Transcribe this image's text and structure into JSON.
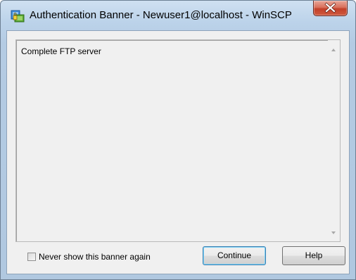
{
  "window": {
    "title": "Authentication Banner - Newuser1@localhost - WinSCP",
    "app_icon": "winscp-app-icon",
    "close_icon": "close-icon"
  },
  "banner": {
    "text": "Complete FTP server"
  },
  "footer": {
    "checkbox_label": "Never show this banner again",
    "checkbox_checked": false,
    "continue_label": "Continue",
    "help_label": "Help"
  },
  "colors": {
    "title_bar": "#bcd3ea",
    "client_bg": "#f0f0f0",
    "close_button": "#c2402a",
    "default_button_border": "#3c7fb1"
  }
}
